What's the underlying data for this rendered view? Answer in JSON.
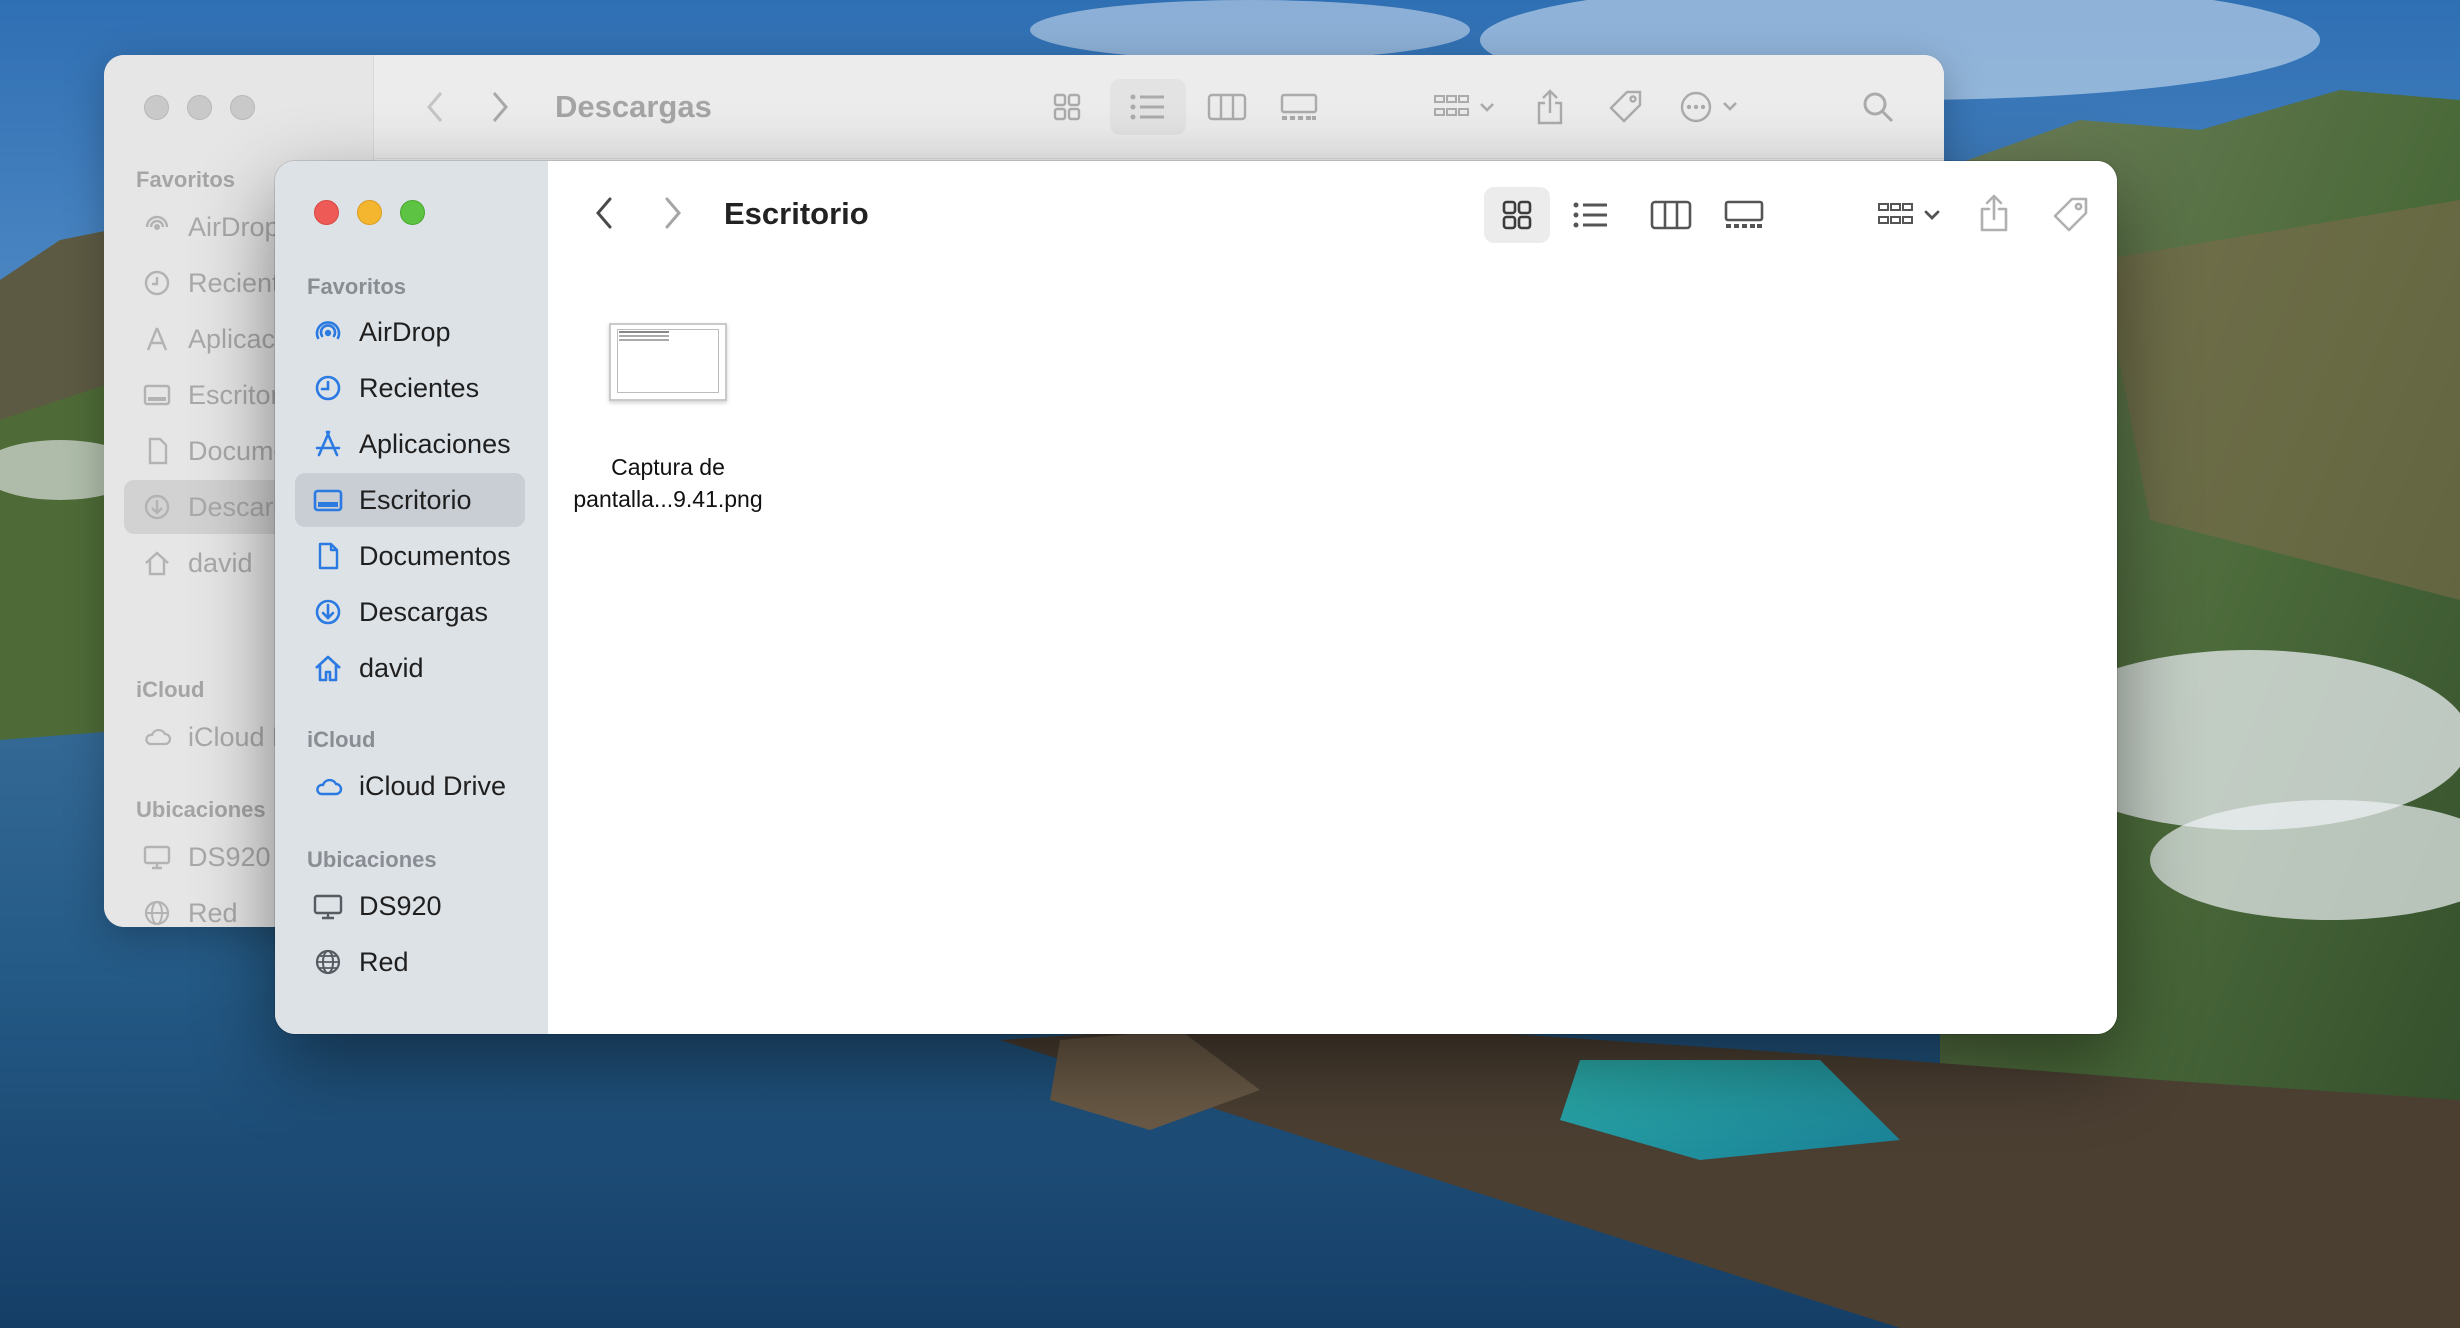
{
  "back_window": {
    "title": "Descargas",
    "sidebar": {
      "favorites_title": "Favoritos",
      "items": [
        "AirDrop",
        "Recient",
        "Aplicaci",
        "Escritor",
        "Docume",
        "Descarg",
        "david"
      ],
      "icloud_title": "iCloud",
      "icloud_items": [
        "iCloud D"
      ],
      "locations_title": "Ubicaciones",
      "location_items": [
        "DS920",
        "Red"
      ]
    }
  },
  "front_window": {
    "title": "Escritorio",
    "sidebar": {
      "favorites_title": "Favoritos",
      "favorites": [
        {
          "label": "AirDrop",
          "icon": "airdrop-icon"
        },
        {
          "label": "Recientes",
          "icon": "clock-icon"
        },
        {
          "label": "Aplicaciones",
          "icon": "applications-icon"
        },
        {
          "label": "Escritorio",
          "icon": "desktop-icon",
          "selected": true
        },
        {
          "label": "Documentos",
          "icon": "document-icon"
        },
        {
          "label": "Descargas",
          "icon": "download-icon"
        },
        {
          "label": "david",
          "icon": "home-icon"
        }
      ],
      "icloud_title": "iCloud",
      "icloud": [
        {
          "label": "iCloud Drive",
          "icon": "cloud-icon"
        }
      ],
      "locations_title": "Ubicaciones",
      "locations": [
        {
          "label": "DS920",
          "icon": "display-icon"
        },
        {
          "label": "Red",
          "icon": "globe-icon"
        }
      ]
    },
    "files": [
      {
        "name": "Captura de\npantalla...9.41.png",
        "icon": "image-thumbnail-icon"
      }
    ]
  },
  "colors": {
    "accent": "#1f6feb",
    "sidebar_icon": "#2a7ae2",
    "close": "#ee5b56",
    "minimize": "#f4b62f",
    "zoom": "#5dc342"
  }
}
